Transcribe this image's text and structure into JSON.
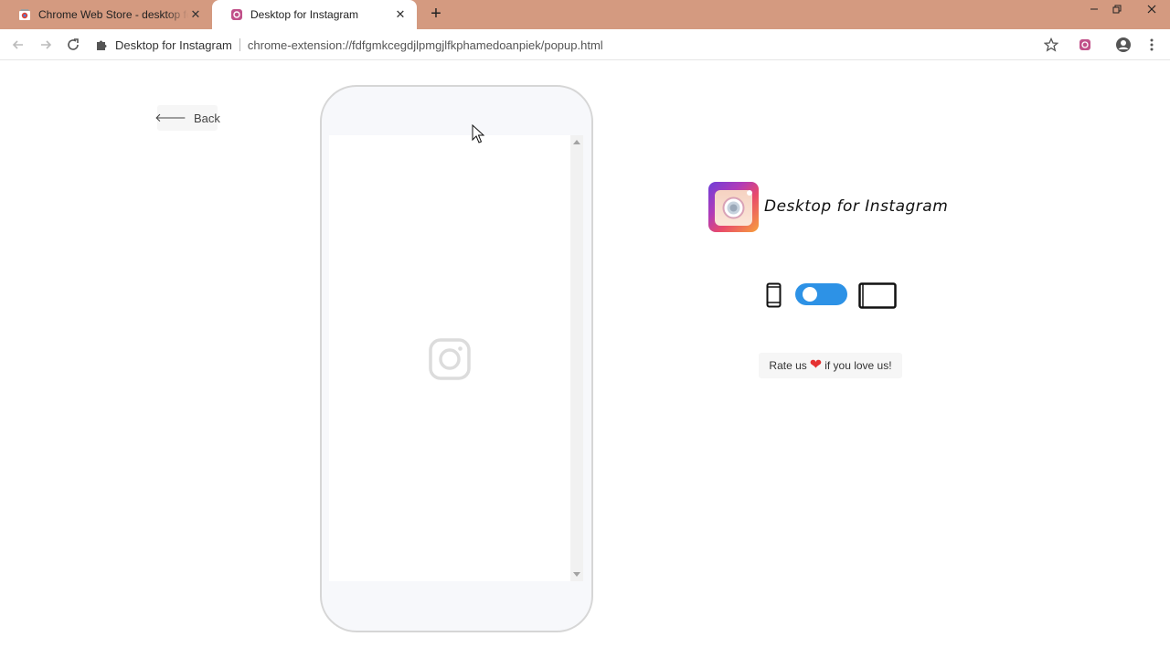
{
  "browser": {
    "tabs": [
      {
        "label": "Chrome Web Store - desktop for",
        "favicon": "chrome-web-store-icon",
        "active": false
      },
      {
        "label": "Desktop for Instagram",
        "favicon": "instagram-extension-icon",
        "active": true
      }
    ],
    "address_bar": {
      "site_label": "Desktop for Instagram",
      "url": "chrome-extension://fdfgmkcegdjlpmgjlfkphamedoanpiek/popup.html"
    }
  },
  "page": {
    "back_label": "Back",
    "logo_title": "Desktop for Instagram",
    "view_toggle": {
      "left_icon": "mobile-phone-icon",
      "right_icon": "tablet-desktop-icon",
      "mode": "mobile"
    },
    "rate": {
      "before": "Rate us",
      "heart": "❤",
      "after": "if you love us!"
    }
  },
  "colors": {
    "titlebar": "#d49a80",
    "toggle": "#2d92e6",
    "heart": "#e53232"
  }
}
